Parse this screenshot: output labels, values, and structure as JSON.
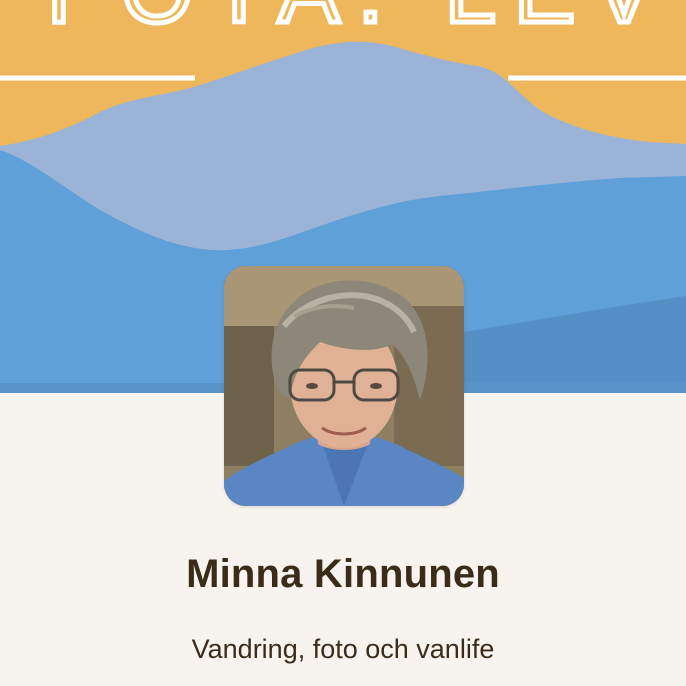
{
  "banner": {
    "image_name": "mountain-landscape-banner",
    "partial_text": ". FOTA. LEV",
    "colors": {
      "sky": "#eeb75c",
      "mountain_far": "#9ab3d6",
      "hills_mid": "#5fa0d8",
      "hills_front": "#548fc5",
      "line": "#ffffff"
    }
  },
  "profile": {
    "avatar_image": "profile-photo-portrait",
    "name": "Minna Kinnunen",
    "tagline": "Vandring, foto och vanlife"
  },
  "colors": {
    "page_background": "#f7f4ef",
    "text": "#3a2c19"
  }
}
